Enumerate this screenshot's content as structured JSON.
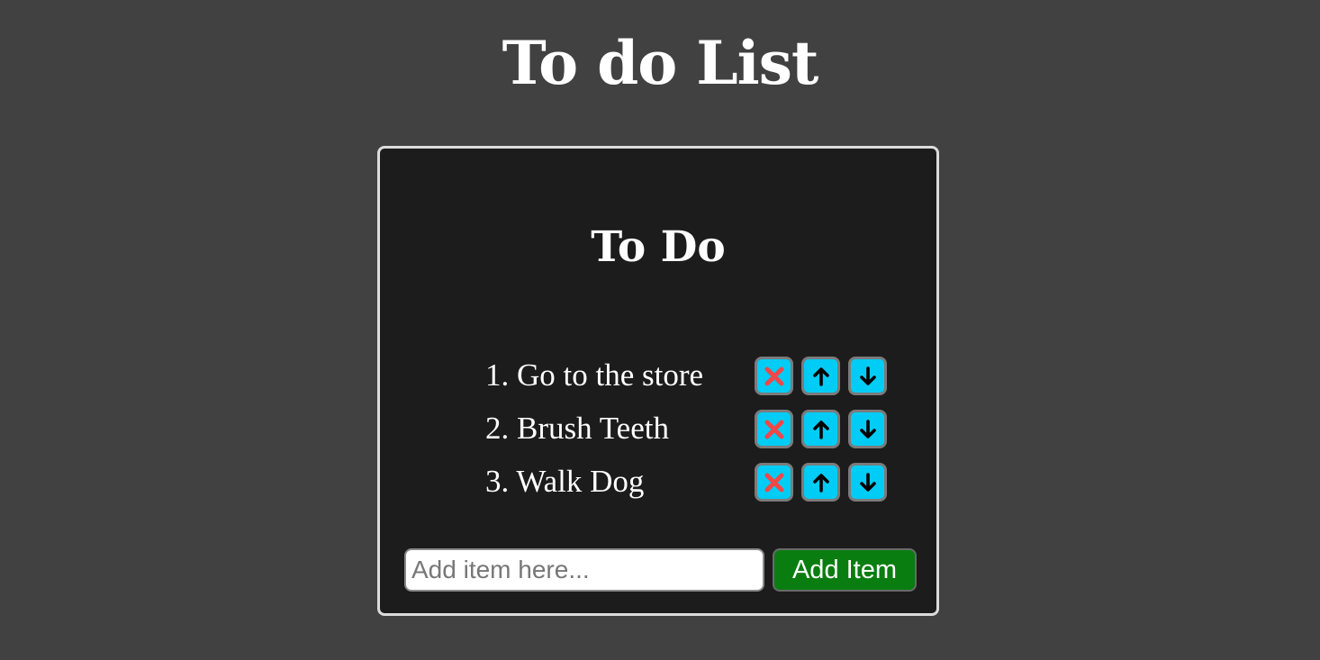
{
  "page": {
    "title": "To do List"
  },
  "card": {
    "title": "To Do"
  },
  "todos": [
    {
      "number": "1.",
      "text": "Go to the store"
    },
    {
      "number": "2.",
      "text": "Brush Teeth"
    },
    {
      "number": "3.",
      "text": "Walk Dog"
    }
  ],
  "item_actions": {
    "delete_icon": "close-icon",
    "up_icon": "arrow-up-icon",
    "down_icon": "arrow-down-icon"
  },
  "add_form": {
    "input_placeholder": "Add item here...",
    "input_value": "",
    "button_label": "Add Item"
  },
  "colors": {
    "page_background": "#424141",
    "card_background": "#1c1c1c",
    "card_border": "#dcdcdc",
    "action_button": "#00ccf5",
    "delete_icon": "#f04848",
    "add_button": "#0a7d10"
  }
}
